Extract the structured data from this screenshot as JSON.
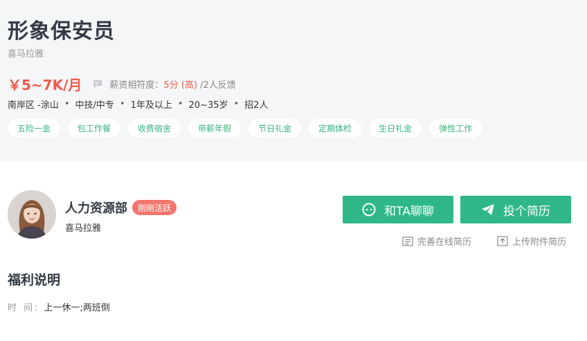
{
  "job": {
    "title": "形象保安员",
    "company": "喜马拉雅",
    "salary": "￥5~7K/月",
    "match_label": "薪资相符度：",
    "match_score": "5分 (高)",
    "match_feedback": "/2人反馈",
    "info": [
      "南岸区 -涂山",
      "中技/中专",
      "1年及以上",
      "20~35岁",
      "招2人"
    ],
    "tags": [
      "五险一金",
      "包工作餐",
      "收费宿舍",
      "带薪年假",
      "节日礼金",
      "定期体检",
      "生日礼金",
      "弹性工作"
    ]
  },
  "hr": {
    "name": "人力资源部",
    "badge": "刚刚活跃",
    "company": "喜马拉雅"
  },
  "actions": {
    "chat_label": "和TA聊聊",
    "resume_label": "投个简历",
    "online_resume_label": "完善在线简历",
    "upload_resume_label": "上传附件简历"
  },
  "welfare": {
    "title": "福利说明",
    "time_label": "时 间:",
    "time_value": "上一休一;两班倒"
  },
  "colors": {
    "accent": "#2fb788",
    "salary": "#f15a4a",
    "badge": "#f2766d",
    "tag_text": "#38b47f"
  },
  "icons": [
    "comment-icon",
    "chat-icon",
    "send-icon",
    "resume-doc-icon",
    "upload-icon"
  ]
}
